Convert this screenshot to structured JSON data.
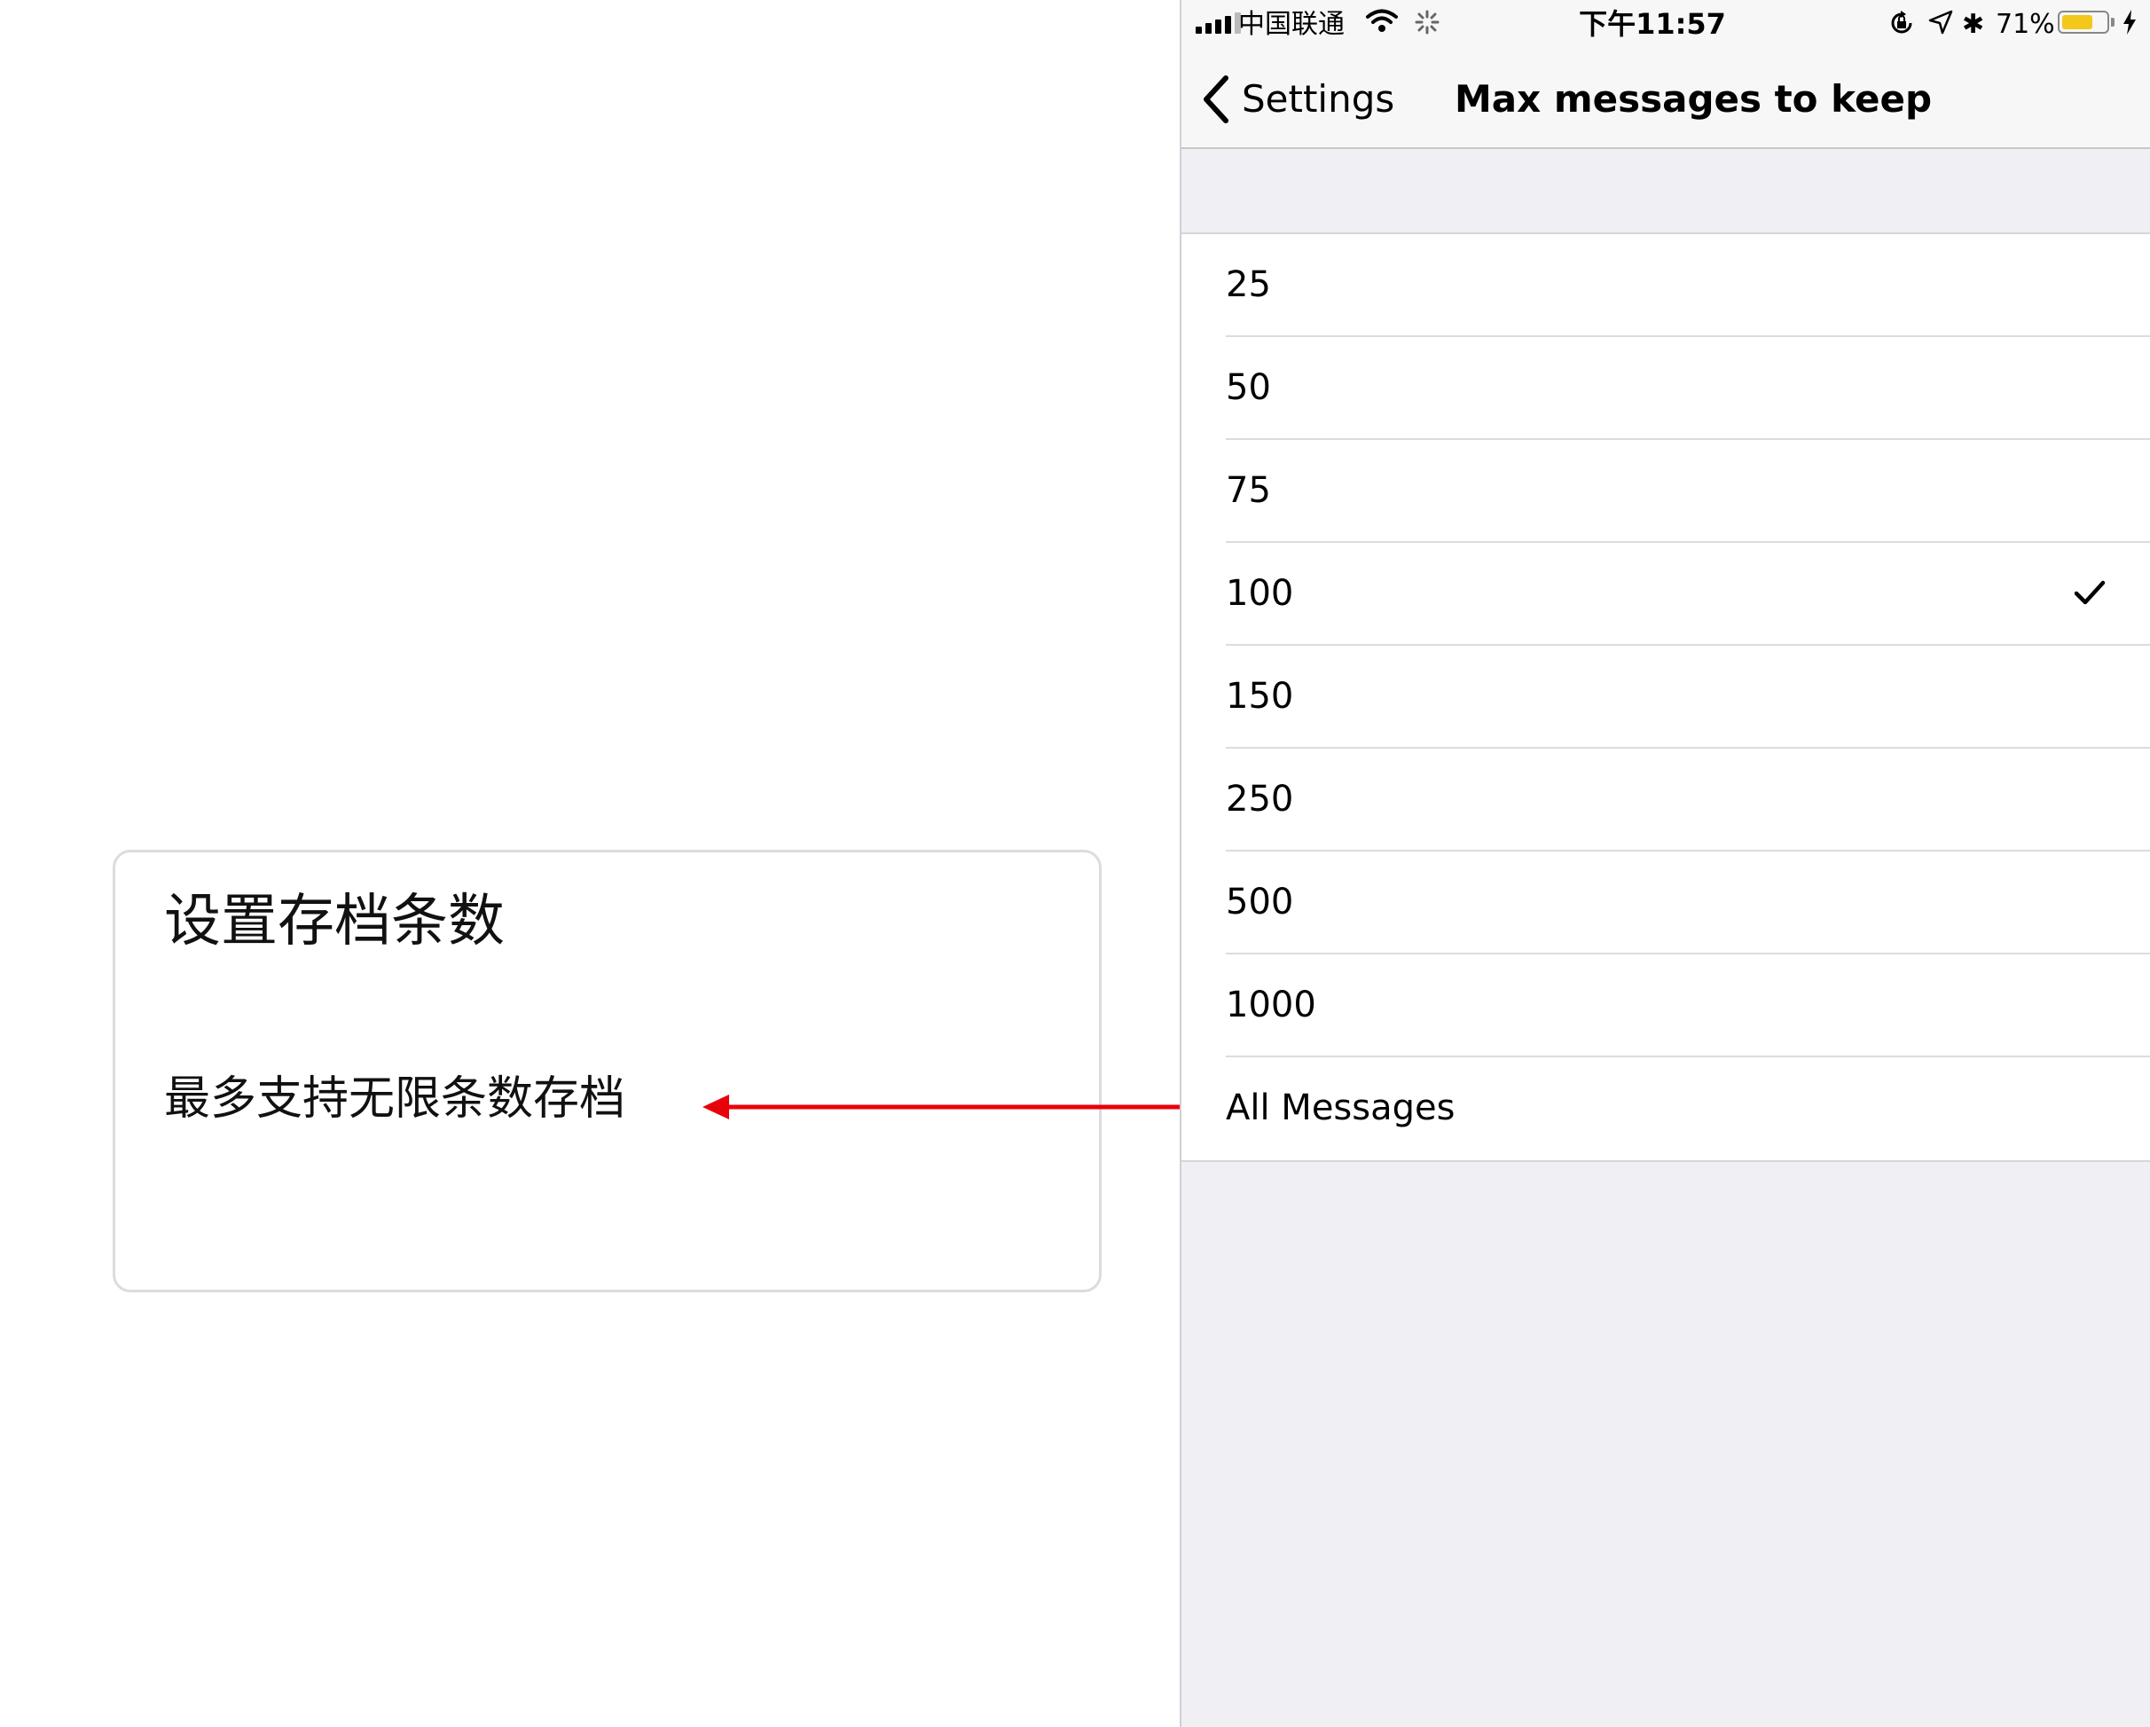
{
  "annotation": {
    "title": "设置存档条数",
    "description": "最多支持无限条数存档",
    "arrow_color": "#e8000b"
  },
  "status_bar": {
    "carrier": "中国联通",
    "time": "下午11:57",
    "battery_percent": "71%",
    "battery_level": 0.71,
    "battery_color": "#f3c81b",
    "icons": [
      "signal-icon",
      "wifi-icon",
      "activity-icon",
      "rotation-lock-icon",
      "location-icon",
      "bluetooth-icon",
      "battery-icon",
      "charging-icon"
    ]
  },
  "nav": {
    "back_label": "Settings",
    "title": "Max messages to keep"
  },
  "options": [
    {
      "label": "25",
      "selected": false
    },
    {
      "label": "50",
      "selected": false
    },
    {
      "label": "75",
      "selected": false
    },
    {
      "label": "100",
      "selected": true
    },
    {
      "label": "150",
      "selected": false
    },
    {
      "label": "250",
      "selected": false
    },
    {
      "label": "500",
      "selected": false
    },
    {
      "label": "1000",
      "selected": false
    },
    {
      "label": "All Messages",
      "selected": false
    }
  ]
}
